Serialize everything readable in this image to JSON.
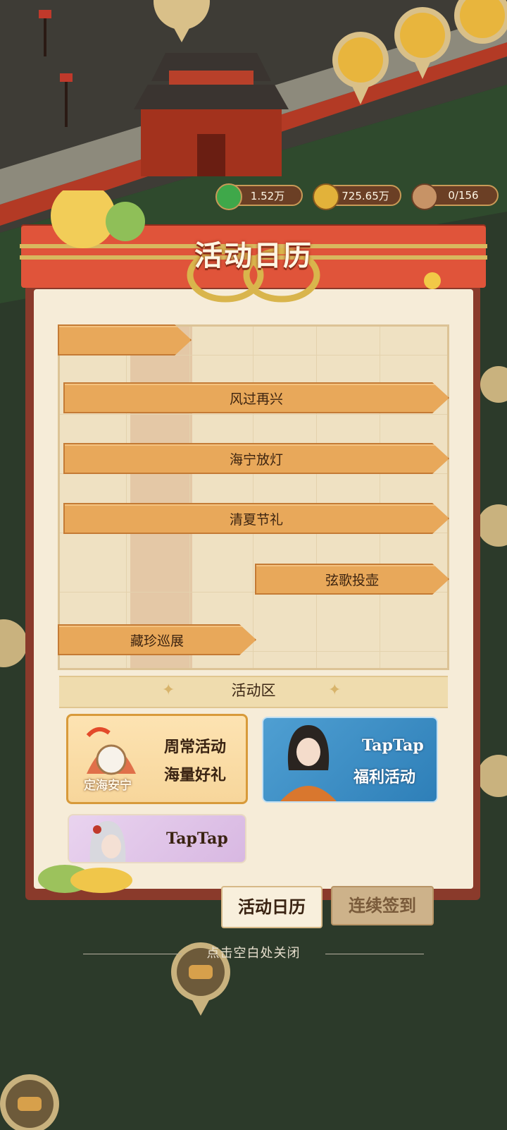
{
  "resources": [
    {
      "name": "jade-coin",
      "value": "1.52万",
      "color": "#3fa84a"
    },
    {
      "name": "copper-coin",
      "value": "725.65万",
      "color": "#e2b23a"
    },
    {
      "name": "population",
      "value": "0/156",
      "color": "#c79366"
    }
  ],
  "panel": {
    "title": "活动日历",
    "calendar_events": [
      {
        "label": ""
      },
      {
        "label": "风过再兴"
      },
      {
        "label": "海宁放灯"
      },
      {
        "label": "清夏节礼"
      },
      {
        "label": "弦歌投壶"
      },
      {
        "label": "藏珍巡展"
      }
    ],
    "section_title": "活动区",
    "cards": [
      {
        "badge": "定海安宁",
        "line1": "周常活动",
        "line2": "海量好礼"
      },
      {
        "line1": "TapTap",
        "line2": "福利活动"
      },
      {
        "line1": "TapTap"
      }
    ],
    "tabs": {
      "active": "活动日历",
      "inactive": "连续签到"
    }
  },
  "hint": "点击空白处关闭",
  "colors": {
    "accent_red": "#e0543a",
    "bar_orange": "#e8a85a",
    "paper": "#f6ecd8"
  }
}
